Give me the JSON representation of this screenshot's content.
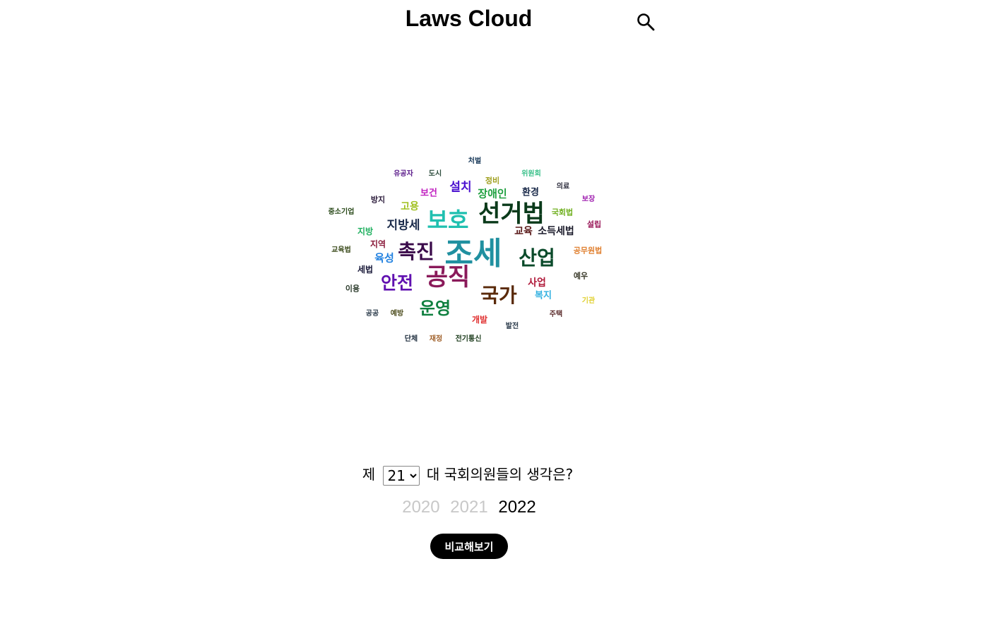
{
  "header": {
    "title": "Laws Cloud",
    "search_icon": "search-icon"
  },
  "word_cloud": {
    "words": [
      {
        "text": "처벌",
        "color": "#1a3a5a"
      },
      {
        "text": "유공자",
        "color": "#5a1a8a"
      },
      {
        "text": "도시",
        "color": "#2a4a3a"
      },
      {
        "text": "위원회",
        "color": "#3ac08a"
      },
      {
        "text": "정비",
        "color": "#a0a020"
      },
      {
        "text": "의료",
        "color": "#2a2a3a"
      },
      {
        "text": "보건",
        "color": "#c020c0"
      },
      {
        "text": "설치",
        "color": "#4a10d0"
      },
      {
        "text": "장애인",
        "color": "#20a040"
      },
      {
        "text": "환경",
        "color": "#1a2a4a"
      },
      {
        "text": "방지",
        "color": "#2a1a3a"
      },
      {
        "text": "보장",
        "color": "#a020b0"
      },
      {
        "text": "고용",
        "color": "#a0c020"
      },
      {
        "text": "중소기업",
        "color": "#2a4a1a"
      },
      {
        "text": "보호",
        "color": "#20c0b0"
      },
      {
        "text": "선거법",
        "color": "#0a3a1a"
      },
      {
        "text": "국회법",
        "color": "#70b020"
      },
      {
        "text": "설립",
        "color": "#9a1a5a"
      },
      {
        "text": "지방",
        "color": "#20b060"
      },
      {
        "text": "지방세",
        "color": "#1a2a4a"
      },
      {
        "text": "교육",
        "color": "#5a1a1a"
      },
      {
        "text": "소득세법",
        "color": "#1a1a2a"
      },
      {
        "text": "교육법",
        "color": "#3a4a1a"
      },
      {
        "text": "지역",
        "color": "#8a1a3a"
      },
      {
        "text": "공무원법",
        "color": "#e08030"
      },
      {
        "text": "촉진",
        "color": "#3a0a4a"
      },
      {
        "text": "조세",
        "color": "#2090a0"
      },
      {
        "text": "산업",
        "color": "#0a4a2a"
      },
      {
        "text": "육성",
        "color": "#2080e0"
      },
      {
        "text": "세법",
        "color": "#1a1a3a"
      },
      {
        "text": "예우",
        "color": "#3a3a2a"
      },
      {
        "text": "공직",
        "color": "#8a1a5a"
      },
      {
        "text": "안전",
        "color": "#6010b0"
      },
      {
        "text": "사업",
        "color": "#b01a3a"
      },
      {
        "text": "이용",
        "color": "#2a3a2a"
      },
      {
        "text": "국가",
        "color": "#5a2a0a"
      },
      {
        "text": "복지",
        "color": "#30b0e0"
      },
      {
        "text": "기관",
        "color": "#e0d030"
      },
      {
        "text": "운영",
        "color": "#108040"
      },
      {
        "text": "공공",
        "color": "#2a3a4a"
      },
      {
        "text": "예방",
        "color": "#4a4a1a"
      },
      {
        "text": "주택",
        "color": "#5a2a2a"
      },
      {
        "text": "개발",
        "color": "#e03030"
      },
      {
        "text": "발전",
        "color": "#2a3a4a"
      },
      {
        "text": "단체",
        "color": "#1a2a3a"
      },
      {
        "text": "재정",
        "color": "#a0602a"
      },
      {
        "text": "전기통신",
        "color": "#1a3a1a"
      }
    ]
  },
  "question": {
    "prefix": "제",
    "session_selected": "21",
    "suffix": "대 국회의원들의 생각은?"
  },
  "years": [
    {
      "label": "2020",
      "active": false
    },
    {
      "label": "2021",
      "active": false
    },
    {
      "label": "2022",
      "active": true
    }
  ],
  "compare_button": "비교해보기"
}
